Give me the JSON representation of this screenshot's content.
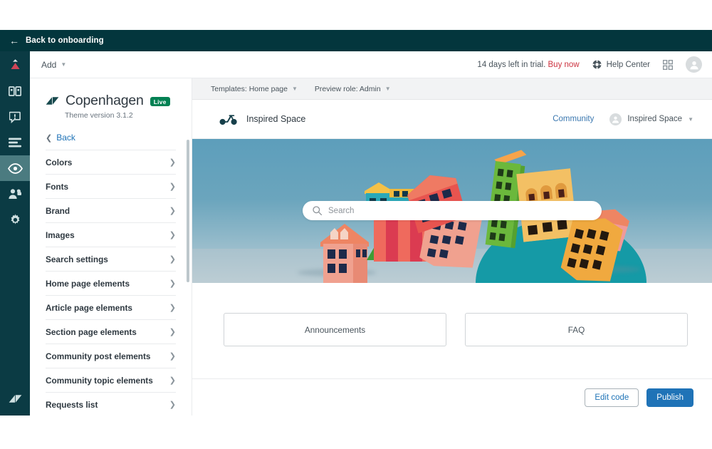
{
  "onboarding_bar": {
    "back_label": "Back to onboarding",
    "back_icon": "arrow-left-icon"
  },
  "rail": {
    "items": [
      {
        "icon": "zendesk-guide-logo",
        "name": "guide-logo"
      },
      {
        "icon": "knowledge-base-icon",
        "name": "knowledge-base"
      },
      {
        "icon": "announcement-icon",
        "name": "announcements"
      },
      {
        "icon": "content-blocks-icon",
        "name": "content-blocks"
      },
      {
        "icon": "eye-icon",
        "name": "customize-design",
        "active": true
      },
      {
        "icon": "user-permissions-icon",
        "name": "user-permissions"
      },
      {
        "icon": "gear-icon",
        "name": "settings"
      }
    ],
    "bottom_icon": "zendesk-logo"
  },
  "topbar": {
    "add_label": "Add",
    "add_icon": "chevron-down-icon",
    "trial_text": "14 days left in trial.",
    "buy_now_label": "Buy now",
    "help_center_label": "Help Center",
    "help_icon": "lifebuoy-icon",
    "apps_icon": "grid-apps-icon",
    "avatar_icon": "user-avatar-icon"
  },
  "panel": {
    "theme_name": "Copenhagen",
    "live_badge": "Live",
    "theme_version": "Theme version 3.1.2",
    "back_label": "Back",
    "back_icon": "chevron-left-icon",
    "items": [
      {
        "label": "Colors"
      },
      {
        "label": "Fonts"
      },
      {
        "label": "Brand"
      },
      {
        "label": "Images"
      },
      {
        "label": "Search settings"
      },
      {
        "label": "Home page elements"
      },
      {
        "label": "Article page elements"
      },
      {
        "label": "Section page elements"
      },
      {
        "label": "Community post elements"
      },
      {
        "label": "Community topic elements"
      },
      {
        "label": "Requests list"
      }
    ],
    "row_chevron_icon": "chevron-right-icon"
  },
  "preview": {
    "toolbar": {
      "templates_label": "Templates: Home page",
      "preview_role_label": "Preview role: Admin",
      "caret_icon": "chevron-down-icon"
    },
    "help_center": {
      "brand_name": "Inspired Space",
      "brand_logo_icon": "bicycle-icon",
      "nav_link": "Community",
      "user_name": "Inspired Space",
      "user_avatar_icon": "user-avatar-icon",
      "user_caret_icon": "chevron-down-icon"
    },
    "hero": {
      "search_placeholder": "Search",
      "search_icon": "search-icon",
      "illustration": "papercraft-city-buildings"
    },
    "blocks": [
      {
        "label": "Announcements"
      },
      {
        "label": "FAQ"
      }
    ]
  },
  "footer": {
    "edit_code_label": "Edit code",
    "publish_label": "Publish"
  },
  "colors": {
    "onboard_bar": "#03363d",
    "rail": "#0b3b44",
    "rail_active": "#4b7b80",
    "accent_red": "#cc3340",
    "link_blue": "#1f73b7",
    "publish_blue": "#1f73b7",
    "live_green": "#038153",
    "hero_sky": "#6ba5bd",
    "hero_hill": "#159aa6"
  }
}
